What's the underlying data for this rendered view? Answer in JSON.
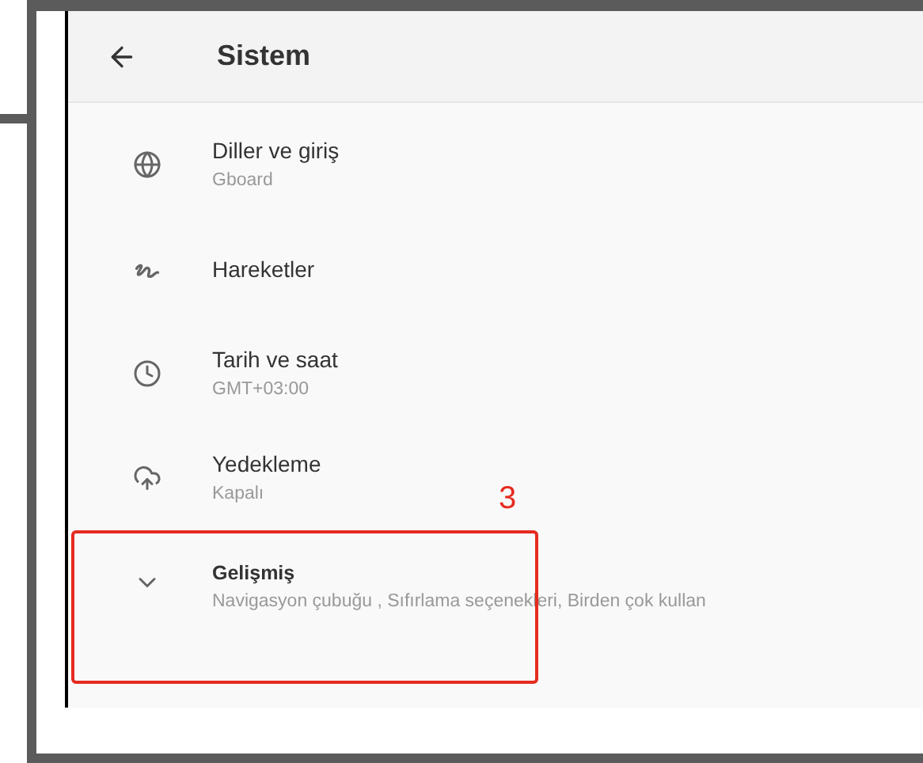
{
  "header": {
    "title": "Sistem"
  },
  "items": [
    {
      "kind": "setting",
      "title": "Diller ve giriş",
      "subtitle": "Gboard",
      "highlighted": false
    },
    {
      "kind": "setting",
      "title": "Hareketler",
      "highlighted": false
    },
    {
      "kind": "setting",
      "title": "Tarih ve saat",
      "subtitle": "GMT+03:00",
      "highlighted": false
    },
    {
      "kind": "setting",
      "title": "Yedekleme",
      "subtitle": "Kapalı",
      "highlighted": false
    },
    {
      "kind": "expandable",
      "title": "Gelişmiş",
      "subtitle": "Navigasyon  çubuğu , Sıfırlama seçenekleri, Birden çok kullan",
      "highlighted": true
    }
  ],
  "annotation": {
    "number": "3"
  }
}
